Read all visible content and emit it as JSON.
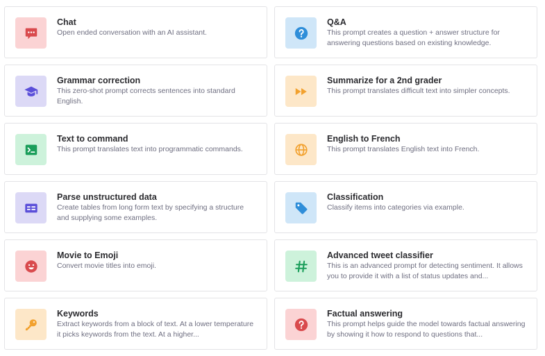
{
  "cards": [
    {
      "title": "Chat",
      "description": "Open ended conversation with an AI assistant.",
      "icon": "chat-icon",
      "tile_bg": "#fbd3d4",
      "icon_color": "#d94a4d"
    },
    {
      "title": "Q&A",
      "description": "This prompt creates a question + answer structure for answering questions based on existing knowledge.",
      "icon": "question-icon",
      "tile_bg": "#cfe6f8",
      "icon_color": "#2f8ed9"
    },
    {
      "title": "Grammar correction",
      "description": "This zero-shot prompt corrects sentences into standard English.",
      "icon": "graduation-cap-icon",
      "tile_bg": "#dcd9f6",
      "icon_color": "#5b4fd9"
    },
    {
      "title": "Summarize for a 2nd grader",
      "description": "This prompt translates difficult text into simpler concepts.",
      "icon": "fast-forward-icon",
      "tile_bg": "#fde7c8",
      "icon_color": "#f2a12e"
    },
    {
      "title": "Text to command",
      "description": "This prompt translates text into programmatic commands.",
      "icon": "terminal-icon",
      "tile_bg": "#cdf2db",
      "icon_color": "#1a9e5a"
    },
    {
      "title": "English to French",
      "description": "This prompt translates English text into French.",
      "icon": "globe-icon",
      "tile_bg": "#fde7c8",
      "icon_color": "#f2a12e"
    },
    {
      "title": "Parse unstructured data",
      "description": "Create tables from long form text by specifying a structure and supplying some examples.",
      "icon": "table-icon",
      "tile_bg": "#dcd9f6",
      "icon_color": "#5b4fd9"
    },
    {
      "title": "Classification",
      "description": "Classify items into categories via example.",
      "icon": "tag-icon",
      "tile_bg": "#cfe6f8",
      "icon_color": "#2f8ed9"
    },
    {
      "title": "Movie to Emoji",
      "description": "Convert movie titles into emoji.",
      "icon": "smiley-icon",
      "tile_bg": "#fbd3d4",
      "icon_color": "#d94a4d"
    },
    {
      "title": "Advanced tweet classifier",
      "description": "This is an advanced prompt for detecting sentiment. It allows you to provide it with a list of status updates and...",
      "icon": "hashtag-icon",
      "tile_bg": "#cdf2db",
      "icon_color": "#1a9e5a"
    },
    {
      "title": "Keywords",
      "description": "Extract keywords from a block of text. At a lower temperature it picks keywords from the text. At a higher...",
      "icon": "key-icon",
      "tile_bg": "#fde7c8",
      "icon_color": "#f2a12e"
    },
    {
      "title": "Factual answering",
      "description": "This prompt helps guide the model towards factual answering by showing it how to respond to questions that...",
      "icon": "question-icon",
      "tile_bg": "#fbd3d4",
      "icon_color": "#d94a4d"
    }
  ]
}
